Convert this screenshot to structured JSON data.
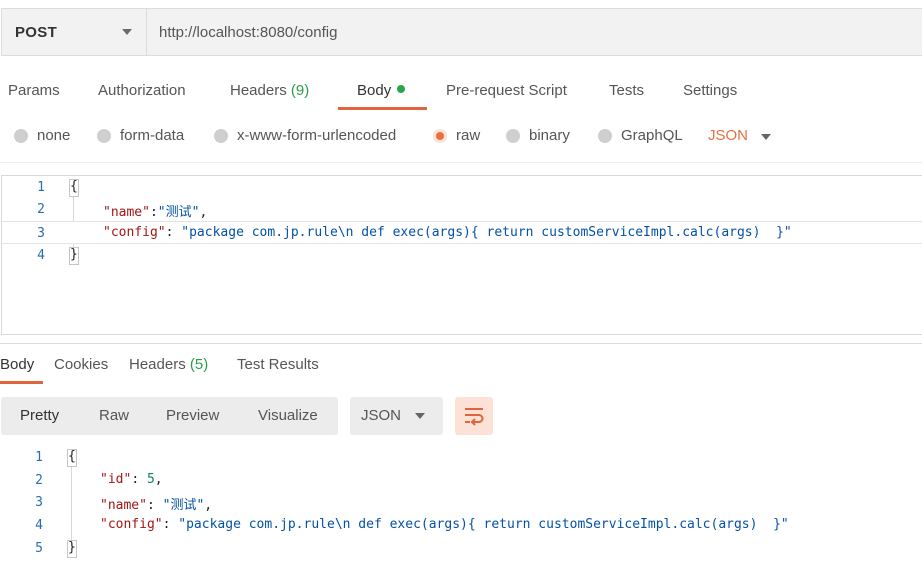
{
  "request": {
    "method": "POST",
    "url": "http://localhost:8080/config"
  },
  "request_tabs": {
    "params": "Params",
    "authorization": "Authorization",
    "headers": "Headers",
    "headers_count": "(9)",
    "body": "Body",
    "prerequest": "Pre-request Script",
    "tests": "Tests",
    "settings": "Settings",
    "active": "Body"
  },
  "body_types": {
    "none": "none",
    "form_data": "form-data",
    "urlencoded": "x-www-form-urlencoded",
    "raw": "raw",
    "binary": "binary",
    "graphql": "GraphQL",
    "selected": "raw",
    "format": "JSON"
  },
  "request_body": {
    "lines": [
      {
        "num": "1",
        "open": "{"
      },
      {
        "num": "2",
        "key": "\"name\"",
        "sep": ":",
        "value": "\"测试\"",
        "end": ","
      },
      {
        "num": "3",
        "key": "\"config\"",
        "sep": ": ",
        "value": "\"package com.jp.rule\\n def exec(args){ return customServiceImpl.calc(args)  }\"",
        "end": ""
      },
      {
        "num": "4",
        "close": "}"
      }
    ]
  },
  "response_tabs": {
    "body": "Body",
    "cookies": "Cookies",
    "headers": "Headers",
    "headers_count": "(5)",
    "test_results": "Test Results",
    "active": "Body"
  },
  "response_view": {
    "pretty": "Pretty",
    "raw": "Raw",
    "preview": "Preview",
    "visualize": "Visualize",
    "format": "JSON",
    "wrap_icon": "wrap-lines-icon"
  },
  "response_body": {
    "lines": [
      {
        "num": "1",
        "open": "{"
      },
      {
        "num": "2",
        "key": "\"id\"",
        "sep": ": ",
        "value": "5",
        "end": ","
      },
      {
        "num": "3",
        "key": "\"name\"",
        "sep": ": ",
        "value": "\"测试\"",
        "end": ","
      },
      {
        "num": "4",
        "key": "\"config\"",
        "sep": ": ",
        "value": "\"package com.jp.rule\\n def exec(args){ return customServiceImpl.calc(args)  }\"",
        "end": ""
      },
      {
        "num": "5",
        "close": "}"
      }
    ]
  },
  "colors": {
    "accent": "#e0643c",
    "count_green": "#2a9d4a",
    "line_number": "#2b6cb0",
    "json_key": "#a31515",
    "json_string": "#0451a5",
    "json_number": "#098658"
  }
}
